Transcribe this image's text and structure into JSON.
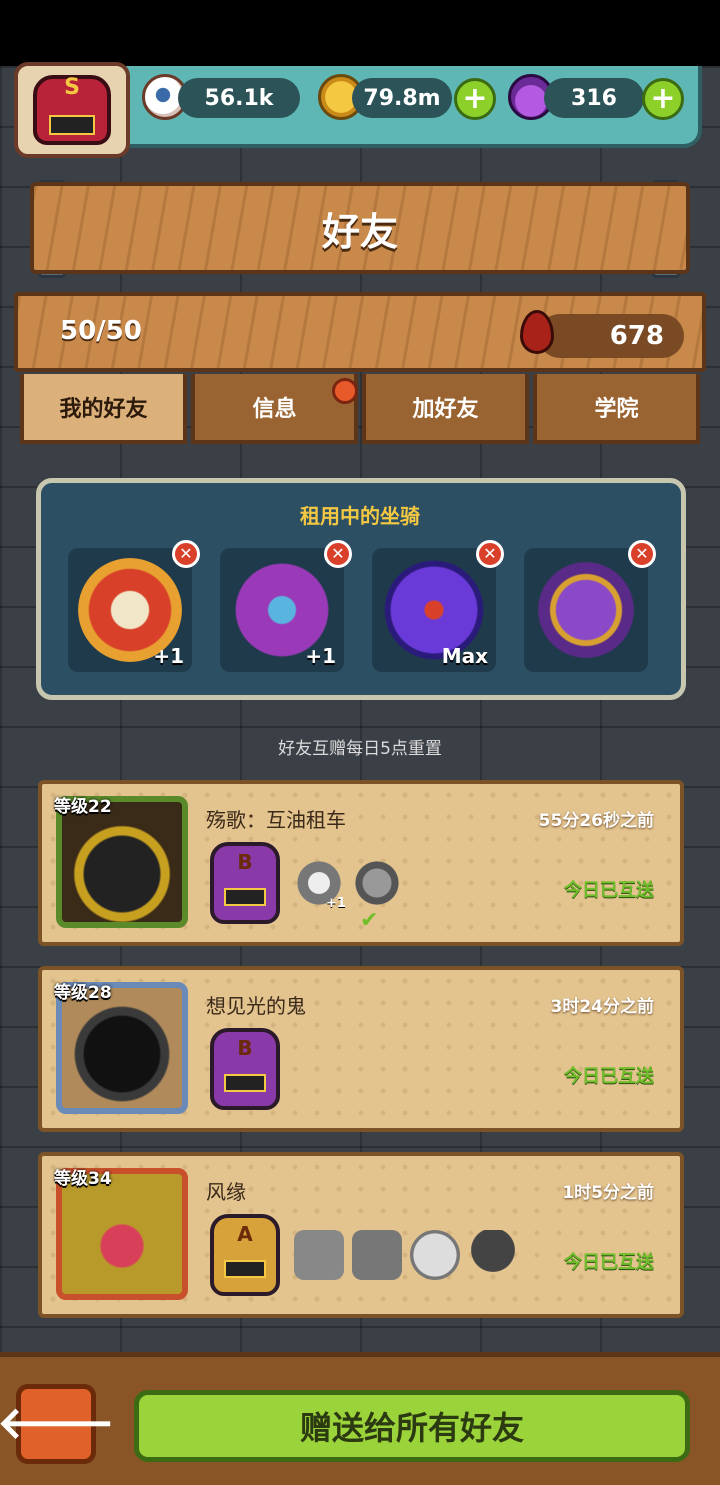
{
  "resources": {
    "eyes": "56.1k",
    "coins": "79.8m",
    "potions": "316",
    "player_rank": "S"
  },
  "page": {
    "title": "好友"
  },
  "stats": {
    "friend_count": "50/50",
    "blood": "678"
  },
  "tabs": [
    {
      "label": "我的好友",
      "active": true
    },
    {
      "label": "信息",
      "notification": true
    },
    {
      "label": "加好友"
    },
    {
      "label": "学院"
    }
  ],
  "mounts": {
    "title": "租用中的坐骑",
    "slots": [
      {
        "name": "lion-dance-mount",
        "tag": "+1"
      },
      {
        "name": "purple-demon-mount",
        "tag": "+1"
      },
      {
        "name": "rose-mount",
        "tag": "Max"
      },
      {
        "name": "throne-cart-mount",
        "tag": ""
      }
    ]
  },
  "reset_note": "好友互赠每日5点重置",
  "friends": [
    {
      "level": "等级22",
      "name": "殇歌：互油租车",
      "time": "55分26秒之前",
      "status": "今日已互送",
      "rank": "B",
      "mini_tag": "+1"
    },
    {
      "level": "等级28",
      "name": "想见光的鬼",
      "time": "3时24分之前",
      "status": "今日已互送",
      "rank": "B"
    },
    {
      "level": "等级34",
      "name": "风缘",
      "time": "1时5分之前",
      "status": "今日已互送",
      "rank": "A"
    }
  ],
  "bottom": {
    "back_icon": "🡐",
    "gift_all_label": "赠送给所有好友"
  },
  "colors": {
    "accent_green": "#9ad43a",
    "mount_title": "#f5c842",
    "status_green": "#6fbe2a"
  }
}
